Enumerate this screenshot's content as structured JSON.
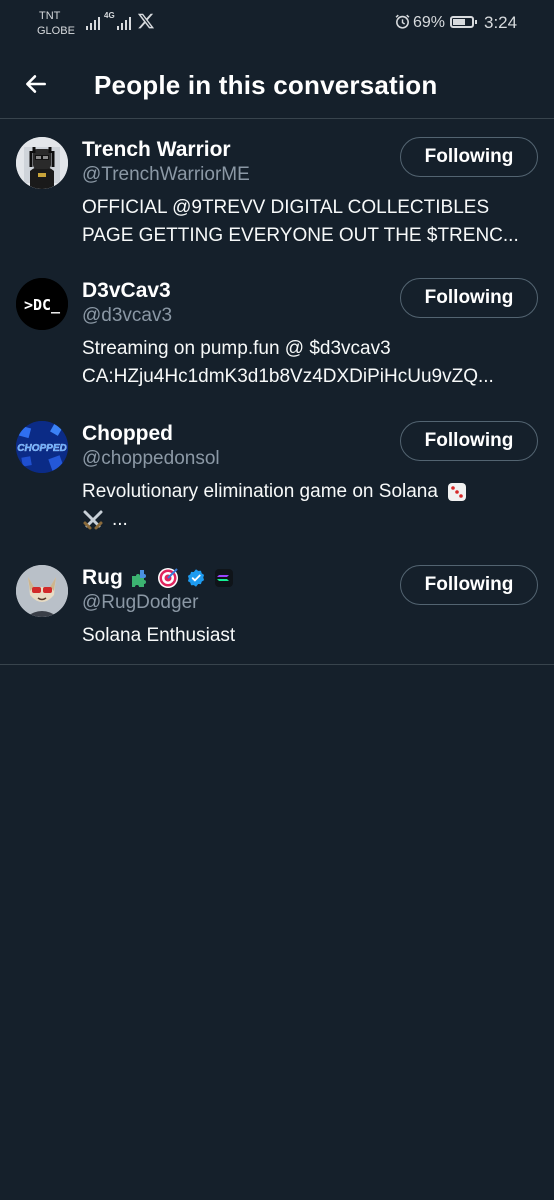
{
  "status_bar": {
    "carrier_line1": "TNT",
    "carrier_line2": "GLOBE",
    "network": "4G",
    "battery": "69%",
    "battery_level": 0.69,
    "time": "3:24"
  },
  "header": {
    "title": "People in this conversation"
  },
  "users": [
    {
      "name": "Trench Warrior",
      "handle": "@TrenchWarriorME",
      "bio_line1": "OFFICIAL @9TREVV DIGITAL COLLECTIBLES",
      "bio_line2": "PAGE GETTING EVERYONE OUT THE $TRENC...",
      "button": "Following"
    },
    {
      "name": "D3vCav3",
      "handle": "@d3vcav3",
      "avatar_text": ">DC_",
      "bio_line1": "Streaming on pump.fun @ $d3vcav3",
      "bio_line2": "CA:HZju4Hc1dmK3d1b8Vz4DXDiPiHcUu9vZQ...",
      "button": "Following"
    },
    {
      "name": "Chopped",
      "handle": "@choppedonsol",
      "avatar_text": "CHOPPED",
      "bio_line1": "Revolutionary elimination game on Solana",
      "bio_line2": "...",
      "button": "Following"
    },
    {
      "name": "Rug",
      "handle": "@RugDodger",
      "bio_line1": "Solana Enthusiast",
      "button": "Following"
    }
  ]
}
